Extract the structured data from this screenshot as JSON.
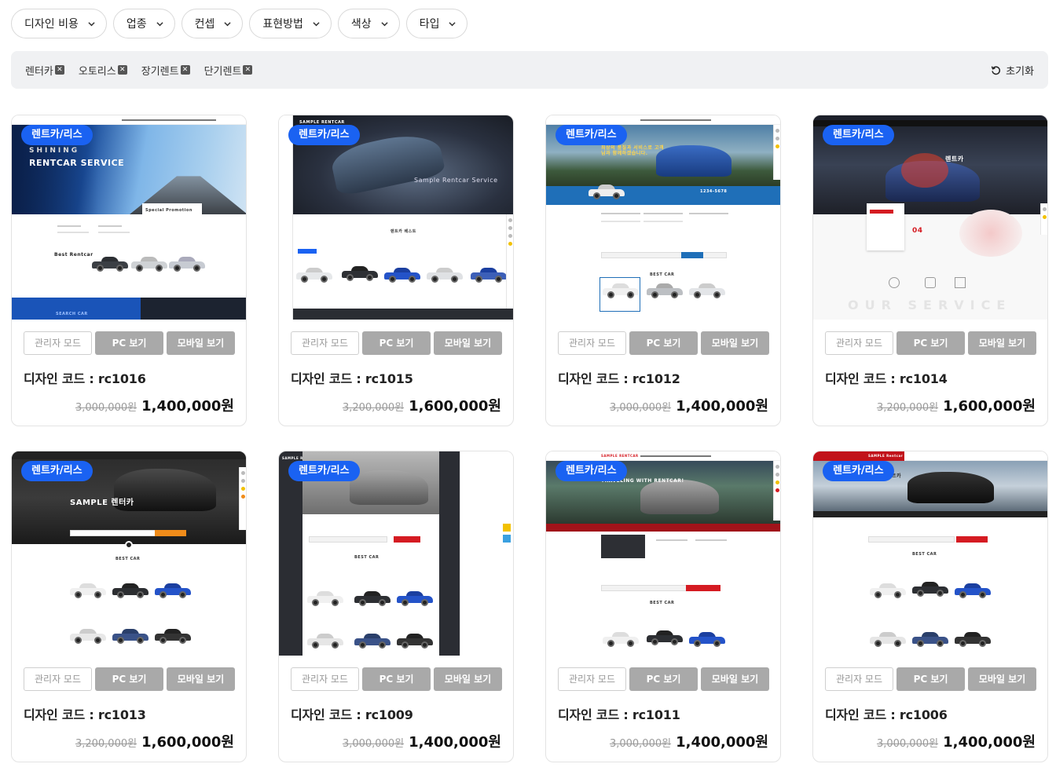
{
  "filters": [
    {
      "label": "디자인 비용"
    },
    {
      "label": "업종"
    },
    {
      "label": "컨셉"
    },
    {
      "label": "표현방법"
    },
    {
      "label": "색상"
    },
    {
      "label": "타입"
    }
  ],
  "active_filters": [
    "렌터카",
    "오토리스",
    "장기렌트",
    "단기렌트"
  ],
  "reset_label": "초기화",
  "card_labels": {
    "badge": "렌트카/리스",
    "admin": "관리자 모드",
    "pc": "PC 보기",
    "mobile": "모바일 보기",
    "code_prefix": "디자인 코드 : "
  },
  "cards": [
    {
      "code": "rc1016",
      "old_price": "3,000,000원",
      "price": "1,400,000원",
      "thumb": {
        "hero_title": "RENTCAR SERVICE",
        "sub_title": "SHINING",
        "section": "Best Rentcar",
        "promo": "Special Promotion",
        "footer": "SEARCH CAR"
      }
    },
    {
      "code": "rc1015",
      "old_price": "3,200,000원",
      "price": "1,600,000원",
      "thumb": {
        "hero_title": "Sample Rentcar Service",
        "section": "렌트카 베스트",
        "logo": "SAMPLE RENTCAR"
      }
    },
    {
      "code": "rc1012",
      "old_price": "3,000,000원",
      "price": "1,400,000원",
      "thumb": {
        "hero_title": "최상의 품질과 서비스로 고객님과 함께하겠습니다.",
        "section": "BEST CAR",
        "phone": "1234-5678"
      }
    },
    {
      "code": "rc1014",
      "old_price": "3,200,000원",
      "price": "1,600,000원",
      "thumb": {
        "hero_title": "렌트카",
        "section": "OUR SERVICE",
        "num": "04"
      }
    },
    {
      "code": "rc1013",
      "old_price": "3,200,000원",
      "price": "1,600,000원",
      "thumb": {
        "hero_title": "SAMPLE 렌터카",
        "section": "BEST CAR"
      }
    },
    {
      "code": "rc1009",
      "old_price": "3,000,000원",
      "price": "1,400,000원",
      "thumb": {
        "logo": "SAMPLE RENTCAR",
        "section": "BEST CAR"
      }
    },
    {
      "code": "rc1011",
      "old_price": "3,000,000원",
      "price": "1,400,000원",
      "thumb": {
        "hero_title": "TRAVELING WITH RENTCAR!",
        "logo": "SAMPLE RENTCAR",
        "section": "BEST CAR"
      }
    },
    {
      "code": "rc1006",
      "old_price": "3,000,000원",
      "price": "1,400,000원",
      "thumb": {
        "logo": "SAMPLE Rentcar",
        "hero_title": "렌트카",
        "section": "BEST CAR"
      }
    }
  ],
  "colors": {
    "badge": "#1a62f2",
    "action_gray": "#a9a9a9",
    "chip_bar": "#f0f1f3",
    "accent_red": "#d51b22"
  }
}
